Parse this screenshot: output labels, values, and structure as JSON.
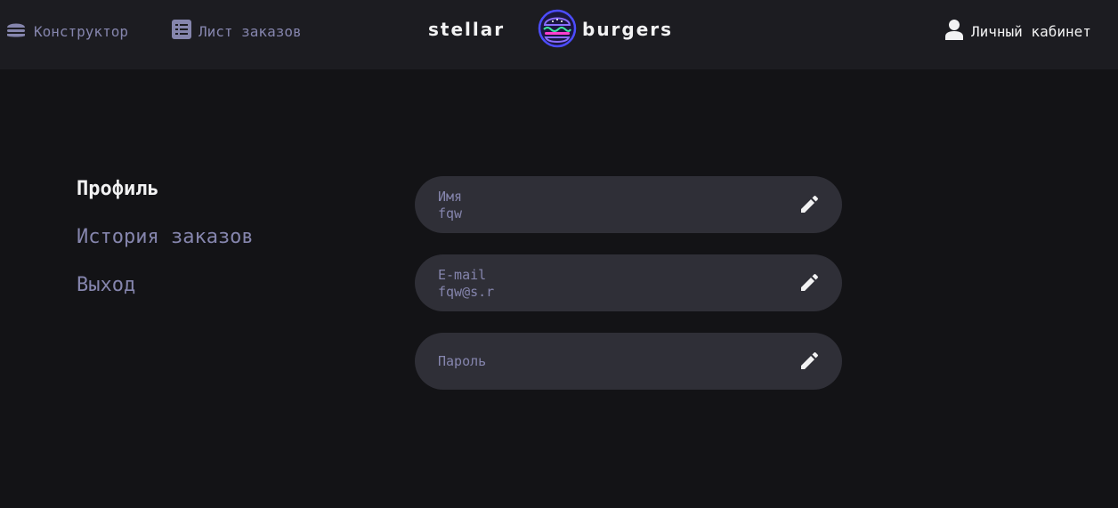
{
  "header": {
    "nav_constructor": {
      "label": "Конструктор",
      "icon": "burger-icon"
    },
    "nav_orders": {
      "label": "Лист заказов",
      "icon": "list-icon"
    },
    "logo": {
      "word_left": "stellar",
      "word_right": "burgers",
      "icon": "burger-logo-icon"
    },
    "nav_account": {
      "label": "Личный кабинет",
      "icon": "user-icon"
    }
  },
  "sidebar": {
    "items": [
      {
        "label": "Профиль",
        "active": true
      },
      {
        "label": "История заказов",
        "active": false
      },
      {
        "label": "Выход",
        "active": false
      }
    ]
  },
  "form": {
    "fields": [
      {
        "label": "Имя",
        "value": "fqw",
        "icon": "edit-icon"
      },
      {
        "label": "E-mail",
        "value": "fqw@s.r",
        "icon": "edit-icon"
      },
      {
        "label": "Пароль",
        "value": "",
        "icon": "edit-icon"
      }
    ]
  },
  "colors": {
    "background": "#131316",
    "header": "#1c1c21",
    "field": "#2f2f37",
    "primary_text": "#f2f2f3",
    "inactive_text": "#8585ad"
  }
}
